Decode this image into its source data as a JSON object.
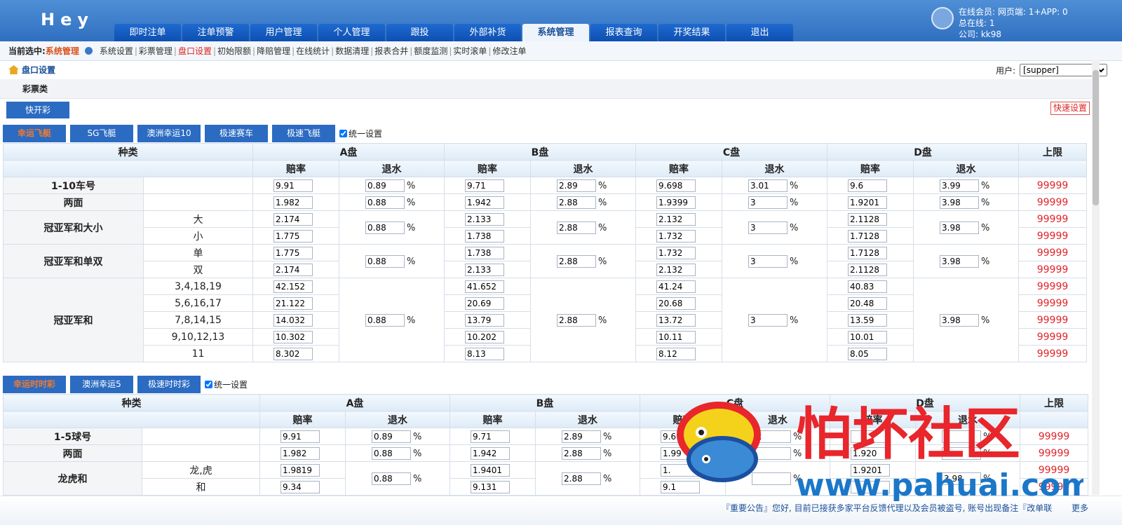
{
  "app": {
    "logo": "Hey"
  },
  "nav": [
    "即时注单",
    "注单预警",
    "用户管理",
    "个人管理",
    "跟投",
    "外部补货",
    "系统管理",
    "报表查询",
    "开奖结果",
    "退出"
  ],
  "nav_active": 6,
  "online": {
    "line1": "在线会员: 网页端: 1+APP: 0",
    "line2": "总在线: 1",
    "line3": "公司: kk98"
  },
  "subnav": {
    "current_label": "当前选中:",
    "current_value": "系统管理",
    "items": [
      "系统设置",
      "彩票管理",
      "盘口设置",
      "初始限额",
      "降赔管理",
      "在线统计",
      "数据清理",
      "报表合并",
      "额度监测",
      "实时滚单",
      "修改注单"
    ],
    "active": 2
  },
  "page": {
    "title": "盘口设置",
    "user_label": "用户:",
    "user_value": "[supper]",
    "type_label": "彩票类",
    "category_tab": "快开彩",
    "quick_set": "快速设置",
    "unify": "统一设置"
  },
  "header": {
    "kind": "种类",
    "plates": [
      "A盘",
      "B盘",
      "C盘",
      "D盘"
    ],
    "limit": "上限",
    "odds": "赔率",
    "rebate": "退水",
    "pct": "%"
  },
  "section1": {
    "tabs": [
      "幸运飞艇",
      "SG飞艇",
      "澳洲幸运10",
      "极速赛车",
      "极速飞艇"
    ],
    "groups": [
      {
        "name": "1-10车号",
        "rows": [
          {
            "sub": "",
            "odds": [
              "9.91",
              "9.71",
              "9.698",
              "9.6"
            ],
            "limit": "99999"
          }
        ],
        "rebate": [
          "0.89",
          "2.89",
          "3.01",
          "3.99"
        ]
      },
      {
        "name": "两面",
        "rows": [
          {
            "sub": "",
            "odds": [
              "1.982",
              "1.942",
              "1.9399",
              "1.9201"
            ],
            "limit": "99999"
          }
        ],
        "rebate": [
          "0.88",
          "2.88",
          "3",
          "3.98"
        ]
      },
      {
        "name": "冠亚军和大小",
        "rows": [
          {
            "sub": "大",
            "odds": [
              "2.174",
              "2.133",
              "2.132",
              "2.1128"
            ],
            "limit": "99999"
          },
          {
            "sub": "小",
            "odds": [
              "1.775",
              "1.738",
              "1.732",
              "1.7128"
            ],
            "limit": "99999"
          }
        ],
        "rebate": [
          "0.88",
          "2.88",
          "3",
          "3.98"
        ]
      },
      {
        "name": "冠亚军和单双",
        "rows": [
          {
            "sub": "单",
            "odds": [
              "1.775",
              "1.738",
              "1.732",
              "1.7128"
            ],
            "limit": "99999"
          },
          {
            "sub": "双",
            "odds": [
              "2.174",
              "2.133",
              "2.132",
              "2.1128"
            ],
            "limit": "99999"
          }
        ],
        "rebate": [
          "0.88",
          "2.88",
          "3",
          "3.98"
        ]
      },
      {
        "name": "冠亚军和",
        "rows": [
          {
            "sub": "3,4,18,19",
            "odds": [
              "42.152",
              "41.652",
              "41.24",
              "40.83"
            ],
            "limit": "99999"
          },
          {
            "sub": "5,6,16,17",
            "odds": [
              "21.122",
              "20.69",
              "20.68",
              "20.48"
            ],
            "limit": "99999"
          },
          {
            "sub": "7,8,14,15",
            "odds": [
              "14.032",
              "13.79",
              "13.72",
              "13.59"
            ],
            "limit": "99999"
          },
          {
            "sub": "9,10,12,13",
            "odds": [
              "10.302",
              "10.202",
              "10.11",
              "10.01"
            ],
            "limit": "99999"
          },
          {
            "sub": "11",
            "odds": [
              "8.302",
              "8.13",
              "8.12",
              "8.05"
            ],
            "limit": "99999"
          }
        ],
        "rebate": [
          "0.88",
          "2.88",
          "3",
          "3.98"
        ]
      }
    ]
  },
  "section2": {
    "tabs": [
      "幸运时时彩",
      "澳洲幸运5",
      "极速时时彩"
    ],
    "groups": [
      {
        "name": "1-5球号",
        "rows": [
          {
            "sub": "",
            "odds": [
              "9.91",
              "9.71",
              "9.69",
              ""
            ],
            "limit": "99999"
          }
        ],
        "rebate": [
          "0.89",
          "2.89",
          "3.",
          ""
        ]
      },
      {
        "name": "两面",
        "rows": [
          {
            "sub": "",
            "odds": [
              "1.982",
              "1.942",
              "1.99",
              "1.920"
            ],
            "limit": "99999"
          }
        ],
        "rebate": [
          "0.88",
          "2.88",
          "",
          ""
        ]
      },
      {
        "name": "龙虎和",
        "rows": [
          {
            "sub": "龙,虎",
            "odds": [
              "1.9819",
              "1.9401",
              "1.",
              "1.9201"
            ],
            "limit": "99999"
          },
          {
            "sub": "和",
            "odds": [
              "9.34",
              "9.131",
              "9.1",
              ""
            ],
            "limit": "99999"
          }
        ],
        "rebate": [
          "0.88",
          "2.88",
          "",
          "3.98"
        ]
      }
    ]
  },
  "watermark": {
    "text": "怕坏社区",
    "url": "www.pahuai.com",
    "colors": {
      "red": "#e8262b",
      "blue": "#1b77c9"
    }
  },
  "footer": {
    "notice": "『重要公告』您好, 目前已接获多家平台反馈代理以及会员被盗号, 账号出现备注『改单联",
    "more": "更多"
  },
  "colors": {
    "nav_blue": "#1f6ad0",
    "top_bar": "#3a7bcb",
    "limit_red": "#e0242b",
    "active_tab": "#f07a30"
  }
}
